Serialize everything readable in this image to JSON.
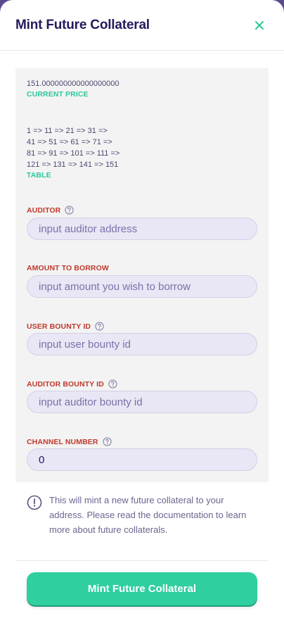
{
  "modal": {
    "title": "Mint Future Collateral"
  },
  "price": {
    "value": "151.000000000000000000",
    "label": "CURRENT PRICE"
  },
  "table": {
    "lines": [
      "1 => 11 => 21 => 31 =>",
      "41 => 51 => 61 => 71 =>",
      "81 => 91 => 101 => 111 =>",
      "121 => 131 => 141 => 151"
    ],
    "label": "TABLE"
  },
  "fields": {
    "auditor": {
      "label": "AUDITOR",
      "placeholder": "input auditor address"
    },
    "amount": {
      "label": "AMOUNT TO BORROW",
      "placeholder": "input amount you wish to borrow"
    },
    "user_bounty": {
      "label": "USER BOUNTY ID",
      "placeholder": "input user bounty id"
    },
    "auditor_bounty": {
      "label": "AUDITOR BOUNTY ID",
      "placeholder": "input auditor bounty id"
    },
    "channel": {
      "label": "CHANNEL NUMBER",
      "value": "0"
    }
  },
  "info": {
    "text": "This will mint a new future collateral to your address. Please read the documentation to learn more about future collaterals."
  },
  "action": {
    "label": "Mint Future Collateral"
  },
  "colors": {
    "accent": "#2fcfa0",
    "title": "#261a5c",
    "warning_label": "#c0392b"
  }
}
